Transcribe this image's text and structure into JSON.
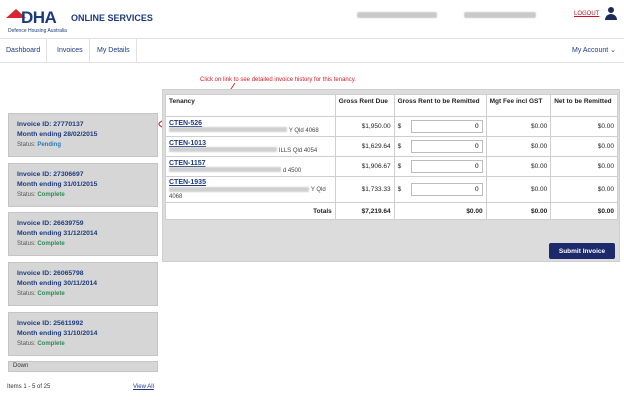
{
  "header": {
    "logo_text": "DHA",
    "logo_sub": "Defence Housing Australia",
    "brand_title": "ONLINE SERVICES",
    "blur_1": "",
    "blur_2": "",
    "logout_label": "LOGOUT",
    "colors": {
      "brand_blue": "#1c3a7d",
      "brand_red": "#d8262e",
      "logout": "#c8102e"
    }
  },
  "nav": {
    "items": [
      "Dashboard",
      "Invoices",
      "My Details"
    ],
    "account_label": "My Account ⌄"
  },
  "annotation": {
    "text": "Click on link to see detailed invoice history for this tenancy.",
    "color": "#d21f2a"
  },
  "invoices": [
    {
      "id": "Invoice ID: 27770137",
      "month": "Month ending 28/02/2015",
      "status_label": "Status: ",
      "status": "Pending"
    },
    {
      "id": "Invoice ID: 27306697",
      "month": "Month ending 31/01/2015",
      "status_label": "Status: ",
      "status": "Complete"
    },
    {
      "id": "Invoice ID: 26639759",
      "month": "Month ending 31/12/2014",
      "status_label": "Status: ",
      "status": "Complete"
    },
    {
      "id": "Invoice ID: 26065798",
      "month": "Month ending 30/11/2014",
      "status_label": "Status: ",
      "status": "Complete"
    },
    {
      "id": "Invoice ID: 25611992",
      "month": "Month ending 31/10/2014",
      "status_label": "Status: ",
      "status": "Complete"
    }
  ],
  "list_footer": {
    "down_label": "Down",
    "items_count": "Items 1 - 5 of 25",
    "view_all": "View All"
  },
  "table": {
    "headers": {
      "tenancy": "Tenancy",
      "gross_rent_due": "Gross Rent Due",
      "gross_rent_remitted": "Gross Rent to be Remitted",
      "mgt_fee": "Mgt Fee incl GST",
      "net_remitted": "Net to be Remitted"
    },
    "rows": [
      {
        "tenancy": "CTEN-526",
        "address": "Y Qld 4068",
        "gross": "$1,950.00",
        "currency": "$",
        "remit": "0",
        "mgt": "$0.00",
        "net": "$0.00"
      },
      {
        "tenancy": "CTEN-1013",
        "address": "ILLS Qld 4054",
        "gross": "$1,629.64",
        "currency": "$",
        "remit": "0",
        "mgt": "$0.00",
        "net": "$0.00"
      },
      {
        "tenancy": "CTEN-1157",
        "address": "d 4500",
        "gross": "$1,906.67",
        "currency": "$",
        "remit": "0",
        "mgt": "$0.00",
        "net": "$0.00"
      },
      {
        "tenancy": "CTEN-1935",
        "address": "Y Qld",
        "address_line2": "4068",
        "gross": "$1,733.33",
        "currency": "$",
        "remit": "0",
        "mgt": "$0.00",
        "net": "$0.00"
      }
    ],
    "totals": {
      "label": "Totals",
      "gross": "$7,219.64",
      "remit": "$0.00",
      "mgt": "$0.00",
      "net": "$0.00"
    }
  },
  "submit_label": "Submit Invoice"
}
